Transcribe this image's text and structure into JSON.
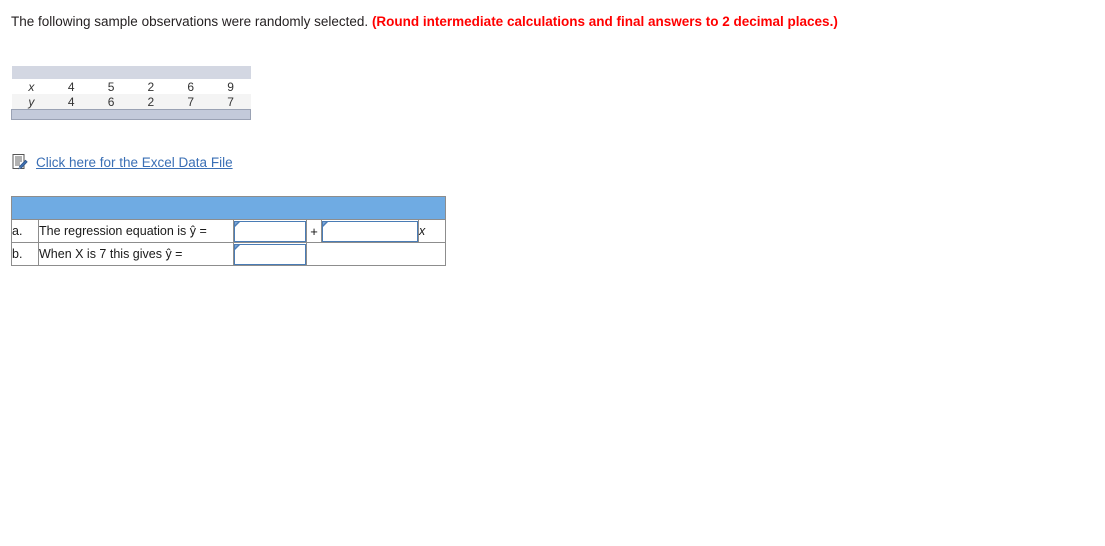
{
  "prompt": {
    "text_normal": "The following sample observations were randomly selected. ",
    "text_emphasis": "(Round intermediate calculations and final answers to 2 decimal places.)"
  },
  "data_table": {
    "row_labels": [
      "x",
      "y"
    ],
    "x_values": [
      "4",
      "5",
      "2",
      "6",
      "9"
    ],
    "y_values": [
      "4",
      "6",
      "2",
      "7",
      "7"
    ]
  },
  "excel": {
    "icon": "excel-document-pencil-icon",
    "link_label": "Click here for the Excel Data File"
  },
  "answer_table": {
    "rows": [
      {
        "letter": "a.",
        "label": "The regression equation is ŷ =",
        "field1_value": "",
        "field1_placeholder": "",
        "operator": "+",
        "field2_value": "",
        "field2_placeholder": "",
        "suffix": "x"
      },
      {
        "letter": "b.",
        "label": "When X is 7 this gives ŷ =",
        "field1_value": "",
        "field1_placeholder": "",
        "operator": "",
        "field2_value": "",
        "field2_placeholder": "",
        "suffix": ""
      }
    ]
  },
  "colors": {
    "emphasis_red": "#ff0000",
    "link_blue": "#3a6fb5",
    "header_blue": "#6fabe3",
    "input_border_blue": "#4a7cb5",
    "data_bar_top": "#d3d7e2",
    "data_bar_bottom": "#c3cada"
  }
}
